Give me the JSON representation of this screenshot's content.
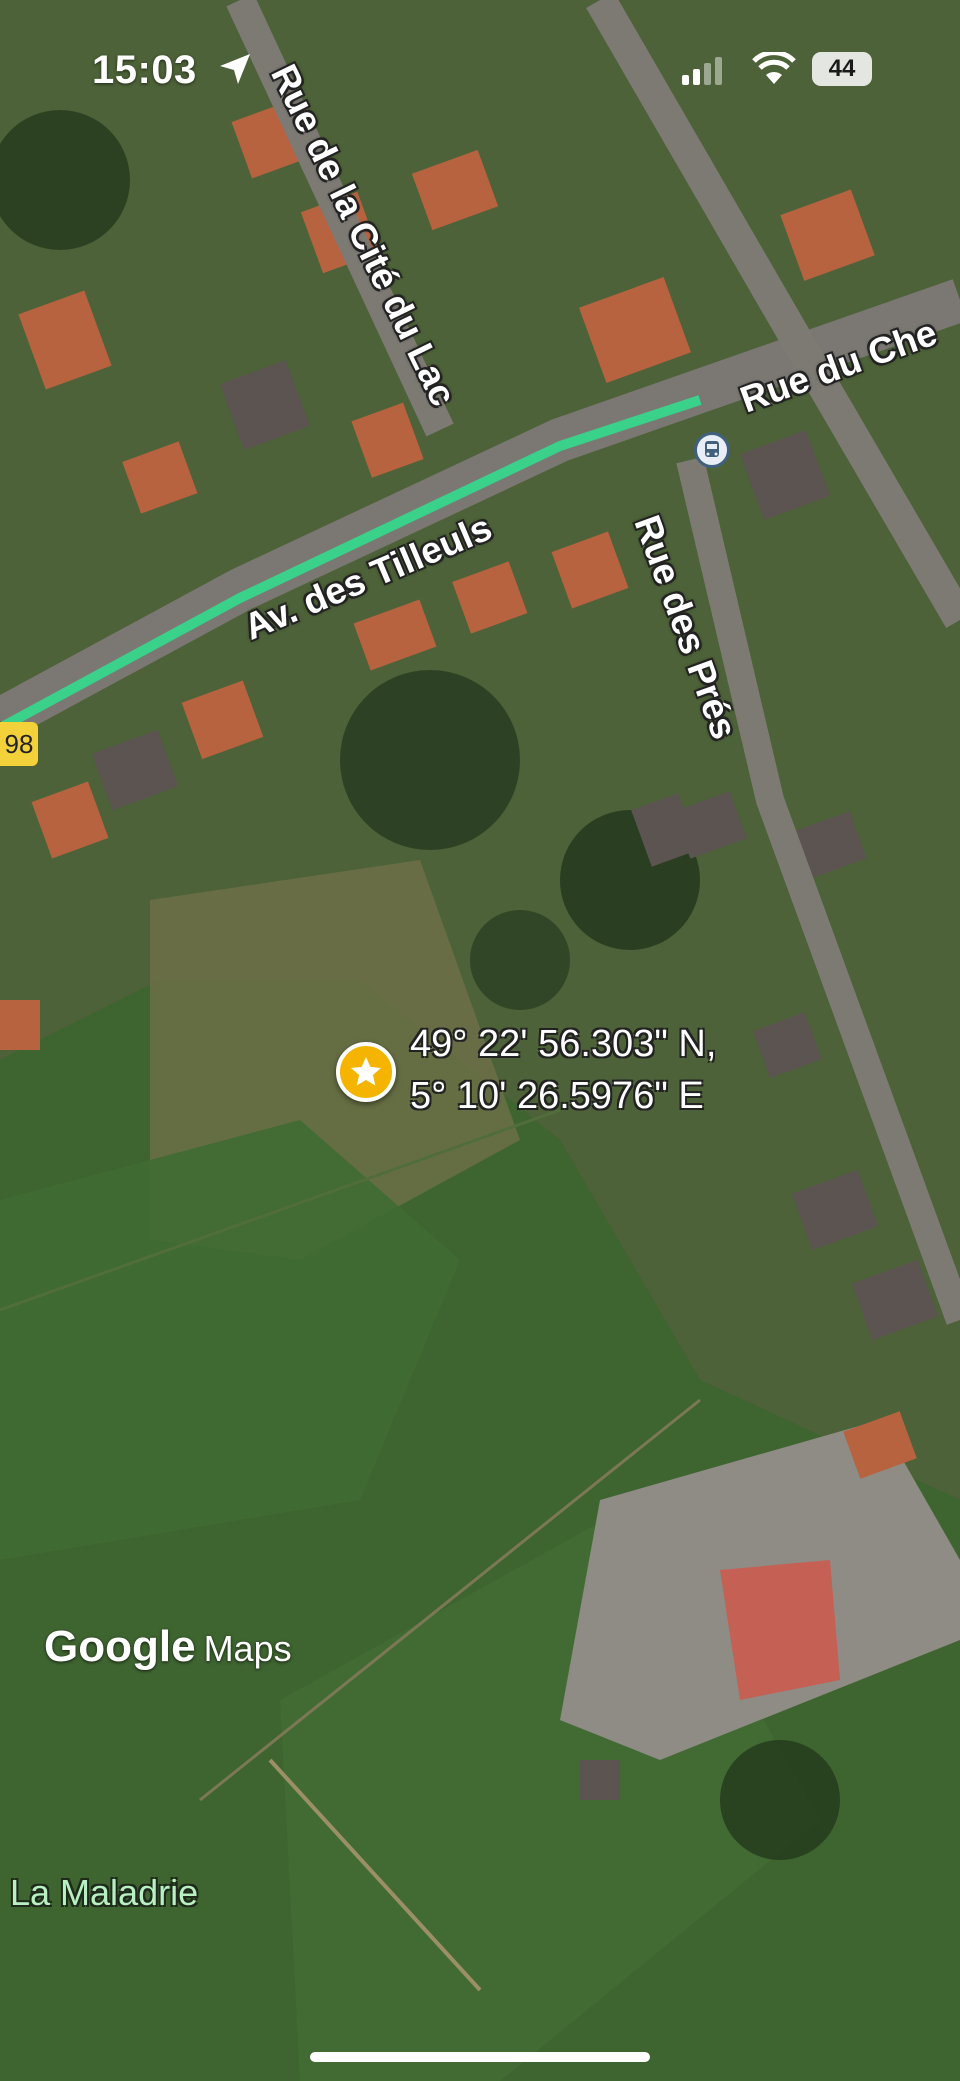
{
  "status_bar": {
    "time": "15:03",
    "battery": "44"
  },
  "map": {
    "roads": {
      "cite_du_lac": "Rue de la Cité du Lac",
      "chemin": "Rue du Che",
      "tilleuls": "Av. des Tilleuls",
      "pres": "Rue des Prés"
    },
    "route_shield": "98",
    "place": "La Maladrie",
    "pin": {
      "lat": "49° 22' 56.303\" N,",
      "lon": "5° 10' 26.5976\" E"
    },
    "logo": {
      "google": "Google",
      "maps": "Maps"
    }
  }
}
